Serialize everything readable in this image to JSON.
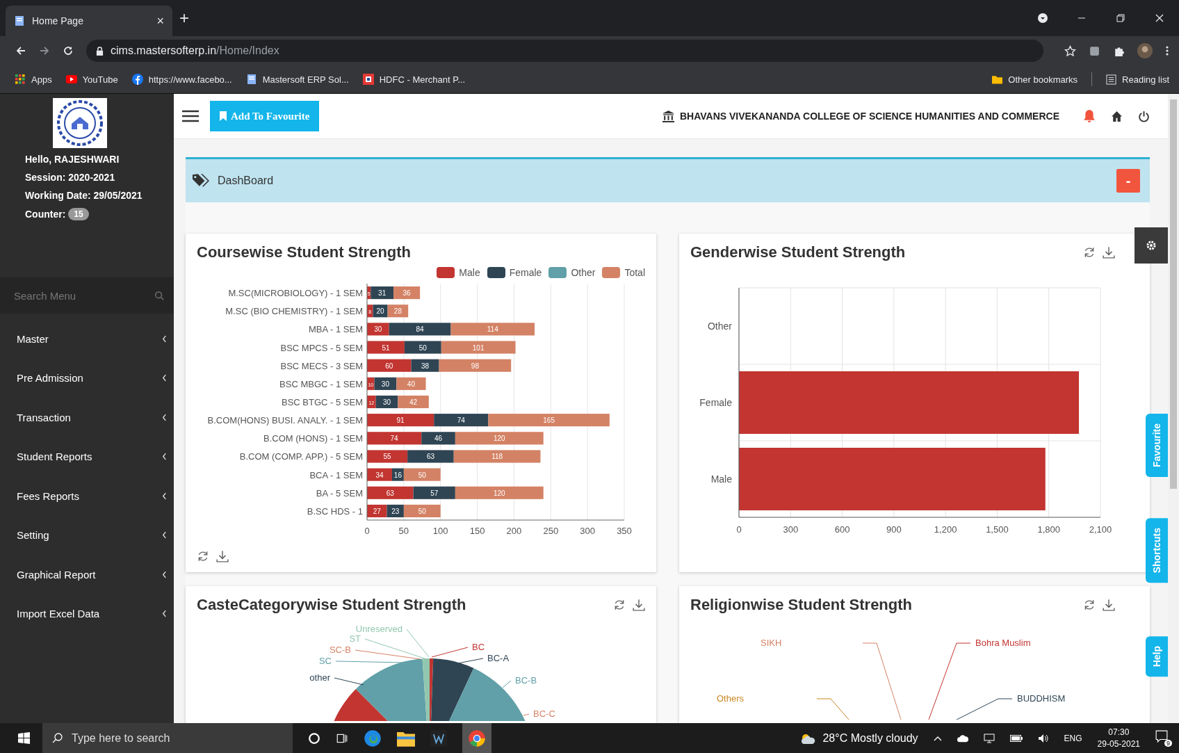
{
  "browser": {
    "tab_title": "Home Page",
    "tab_close": "×",
    "new_tab": "+",
    "address": {
      "host": "cims.mastersofterp.in",
      "path": "/Home/Index"
    },
    "bookmarks": [
      {
        "kind": "apps",
        "label": "Apps"
      },
      {
        "kind": "youtube",
        "label": "YouTube"
      },
      {
        "kind": "facebook",
        "label": "https://www.facebo..."
      },
      {
        "kind": "page",
        "label": "Mastersoft ERP Sol..."
      },
      {
        "kind": "bank",
        "label": "HDFC - Merchant P..."
      }
    ],
    "other_bookmarks": "Other bookmarks",
    "reading_list": "Reading list"
  },
  "sidebar": {
    "greeting": "Hello, RAJESHWARI",
    "session": "Session: 2020-2021",
    "working_date": "Working Date: 29/05/2021",
    "counter": {
      "label": "Counter:",
      "value": "15"
    },
    "search": {
      "placeholder": "Search Menu"
    },
    "menu": [
      {
        "label": "Master",
        "expanded": false
      },
      {
        "label": "Pre Admission",
        "expanded": false
      },
      {
        "label": "Transaction",
        "expanded": false
      },
      {
        "label": "Student Reports",
        "expanded": false
      },
      {
        "label": "Fees Reports",
        "expanded": false
      },
      {
        "label": "Setting",
        "expanded": false
      },
      {
        "label": "Graphical Report",
        "expanded": false
      },
      {
        "label": "Import Excel Data",
        "expanded": false
      }
    ]
  },
  "header": {
    "favourite_button": "Add To Favourite",
    "college": "BHAVANS VIVEKANANDA COLLEGE OF SCIENCE HUMANITIES AND COMMERCE"
  },
  "dashboard": {
    "title": "DashBoard",
    "collapse_symbol": "-"
  },
  "cards": [
    {
      "kind": "stacked_bar",
      "title": "Coursewise Student Strength",
      "chart_data": {
        "type": "bar",
        "orientation": "horizontal",
        "stacked": true,
        "grid": true,
        "data_labels": true,
        "categories": [
          "M.SC(MICROBIOLOGY) - 1 SEM",
          "M.SC (BIO CHEMISTRY) - 1 SEM",
          "MBA - 1 SEM",
          "BSC MPCS - 5 SEM",
          "BSC MECS - 3 SEM",
          "BSC  MBGC - 1 SEM",
          "BSC BTGC - 5 SEM",
          "B.COM(HONS) BUSI. ANALY. - 1 SEM",
          "B.COM (HONS)  - 1 SEM",
          "B.COM (COMP. APP.)  - 5 SEM",
          "BCA - 1 SEM",
          "BA - 5 SEM",
          "B.SC HDS - 1"
        ],
        "series": [
          {
            "name": "Male",
            "color": "#c23531",
            "values": [
              5,
              8,
              30,
              51,
              60,
              10,
              12,
              91,
              74,
              55,
              34,
              63,
              27
            ]
          },
          {
            "name": "Female",
            "color": "#2f4554",
            "values": [
              31,
              20,
              84,
              50,
              38,
              30,
              30,
              74,
              46,
              63,
              16,
              57,
              23
            ]
          },
          {
            "name": "Other",
            "color": "#61a0a8",
            "values": [
              null,
              null,
              null,
              null,
              null,
              null,
              null,
              null,
              null,
              null,
              null,
              null,
              null
            ]
          },
          {
            "name": "Total",
            "color": "#d48265",
            "values": [
              36,
              28,
              114,
              101,
              98,
              40,
              42,
              165,
              120,
              118,
              50,
              120,
              50
            ]
          }
        ],
        "xlim": [
          0,
          350
        ],
        "xticks": [
          0,
          50,
          100,
          150,
          200,
          250,
          300,
          350
        ]
      }
    },
    {
      "kind": "bar",
      "title": "Genderwise Student Strength",
      "chart_data": {
        "type": "bar",
        "orientation": "horizontal",
        "grid": true,
        "categories": [
          "Other",
          "Female",
          "Male"
        ],
        "series": [
          {
            "color": "#c23531",
            "values": [
              0,
              1975,
              1780
            ]
          }
        ],
        "xlim": [
          0,
          2100
        ],
        "xticks": [
          0,
          {
            "value": 300,
            "label": "300"
          },
          {
            "value": 600,
            "label": "600"
          },
          {
            "value": 900,
            "label": "900"
          },
          {
            "value": 1200,
            "label": "1,200"
          },
          {
            "value": 1500,
            "label": "1,500"
          },
          {
            "value": 1800,
            "label": "1,800"
          },
          {
            "value": 2100,
            "label": "2,100"
          }
        ]
      }
    },
    {
      "kind": "caste_pie",
      "title": "CasteCategorywise Student Strength",
      "labels": [
        {
          "label": "Unreserved",
          "color": "#91c7ae"
        },
        {
          "label": "ST",
          "color": "#91c7ae"
        },
        {
          "label": "SC-B",
          "color": "#d48265"
        },
        {
          "label": "SC",
          "color": "#61a0a8"
        },
        {
          "label": "other",
          "color": "#2f4554"
        },
        {
          "label": "BC",
          "color": "#c23531"
        },
        {
          "label": "BC-A",
          "color": "#2f4554"
        },
        {
          "label": "BC-B",
          "color": "#61a0a8"
        },
        {
          "label": "BC-C",
          "color": "#d48265"
        }
      ]
    },
    {
      "kind": "religion_pie",
      "title": "Religionwise Student Strength",
      "labels": [
        {
          "label": "SIKH",
          "color": "#d48265"
        },
        {
          "label": "Bohra Muslim",
          "color": "#c23531"
        },
        {
          "label": "Others",
          "color": "#ca8622"
        },
        {
          "label": "BUDDHISM",
          "color": "#2f4554"
        }
      ]
    }
  ],
  "side_tabs": [
    "Favourite",
    "Shortcuts",
    "Help"
  ],
  "taskbar": {
    "search_placeholder": "Type here to search",
    "weather": "28°C  Mostly cloudy",
    "language": "ENG",
    "time": "07:30",
    "date": "29-05-2021",
    "notifications": "9"
  }
}
